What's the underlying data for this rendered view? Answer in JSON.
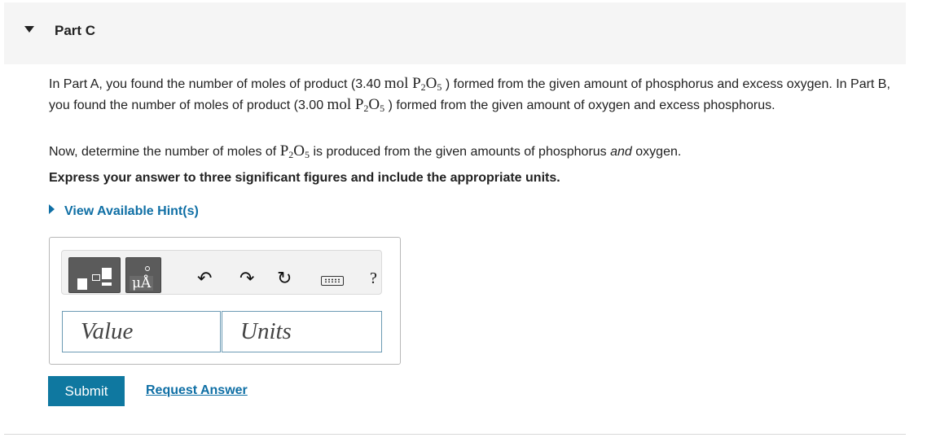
{
  "header": {
    "title": "Part C"
  },
  "question": {
    "p1_a": "In Part A, you found the number of moles of product (3.40 ",
    "p1_chem_a": "mol P",
    "p1_sub_a": "2",
    "p1_chem_b": "O",
    "p1_sub_b": "5",
    "p1_b": " ) formed from the given amount of phosphorus and excess oxygen. In Part B, you found the number of moles of product (3.00 ",
    "p1_chem_c": "mol P",
    "p1_sub_c": "2",
    "p1_chem_d": "O",
    "p1_sub_d": "5",
    "p1_c": " ) formed from the given amount of oxygen and excess phosphorus.",
    "p2_a": "Now, determine the number of moles of ",
    "p2_chem_a": "P",
    "p2_sub_a": "2",
    "p2_chem_b": "O",
    "p2_sub_b": "5",
    "p2_b": " is produced from the given amounts of phosphorus ",
    "p2_em": "and",
    "p2_c": " oxygen.",
    "instruction": "Express your answer to three significant figures and include the appropriate units."
  },
  "hints": {
    "label": "View Available Hint(s)"
  },
  "toolbar": {
    "units_glyph": "μÅ",
    "undo_glyph": "↶",
    "redo_glyph": "↷",
    "reset_glyph": "↻",
    "help_glyph": "?"
  },
  "inputs": {
    "value_placeholder": "Value",
    "units_placeholder": "Units"
  },
  "actions": {
    "submit_label": "Submit",
    "request_label": "Request Answer"
  }
}
